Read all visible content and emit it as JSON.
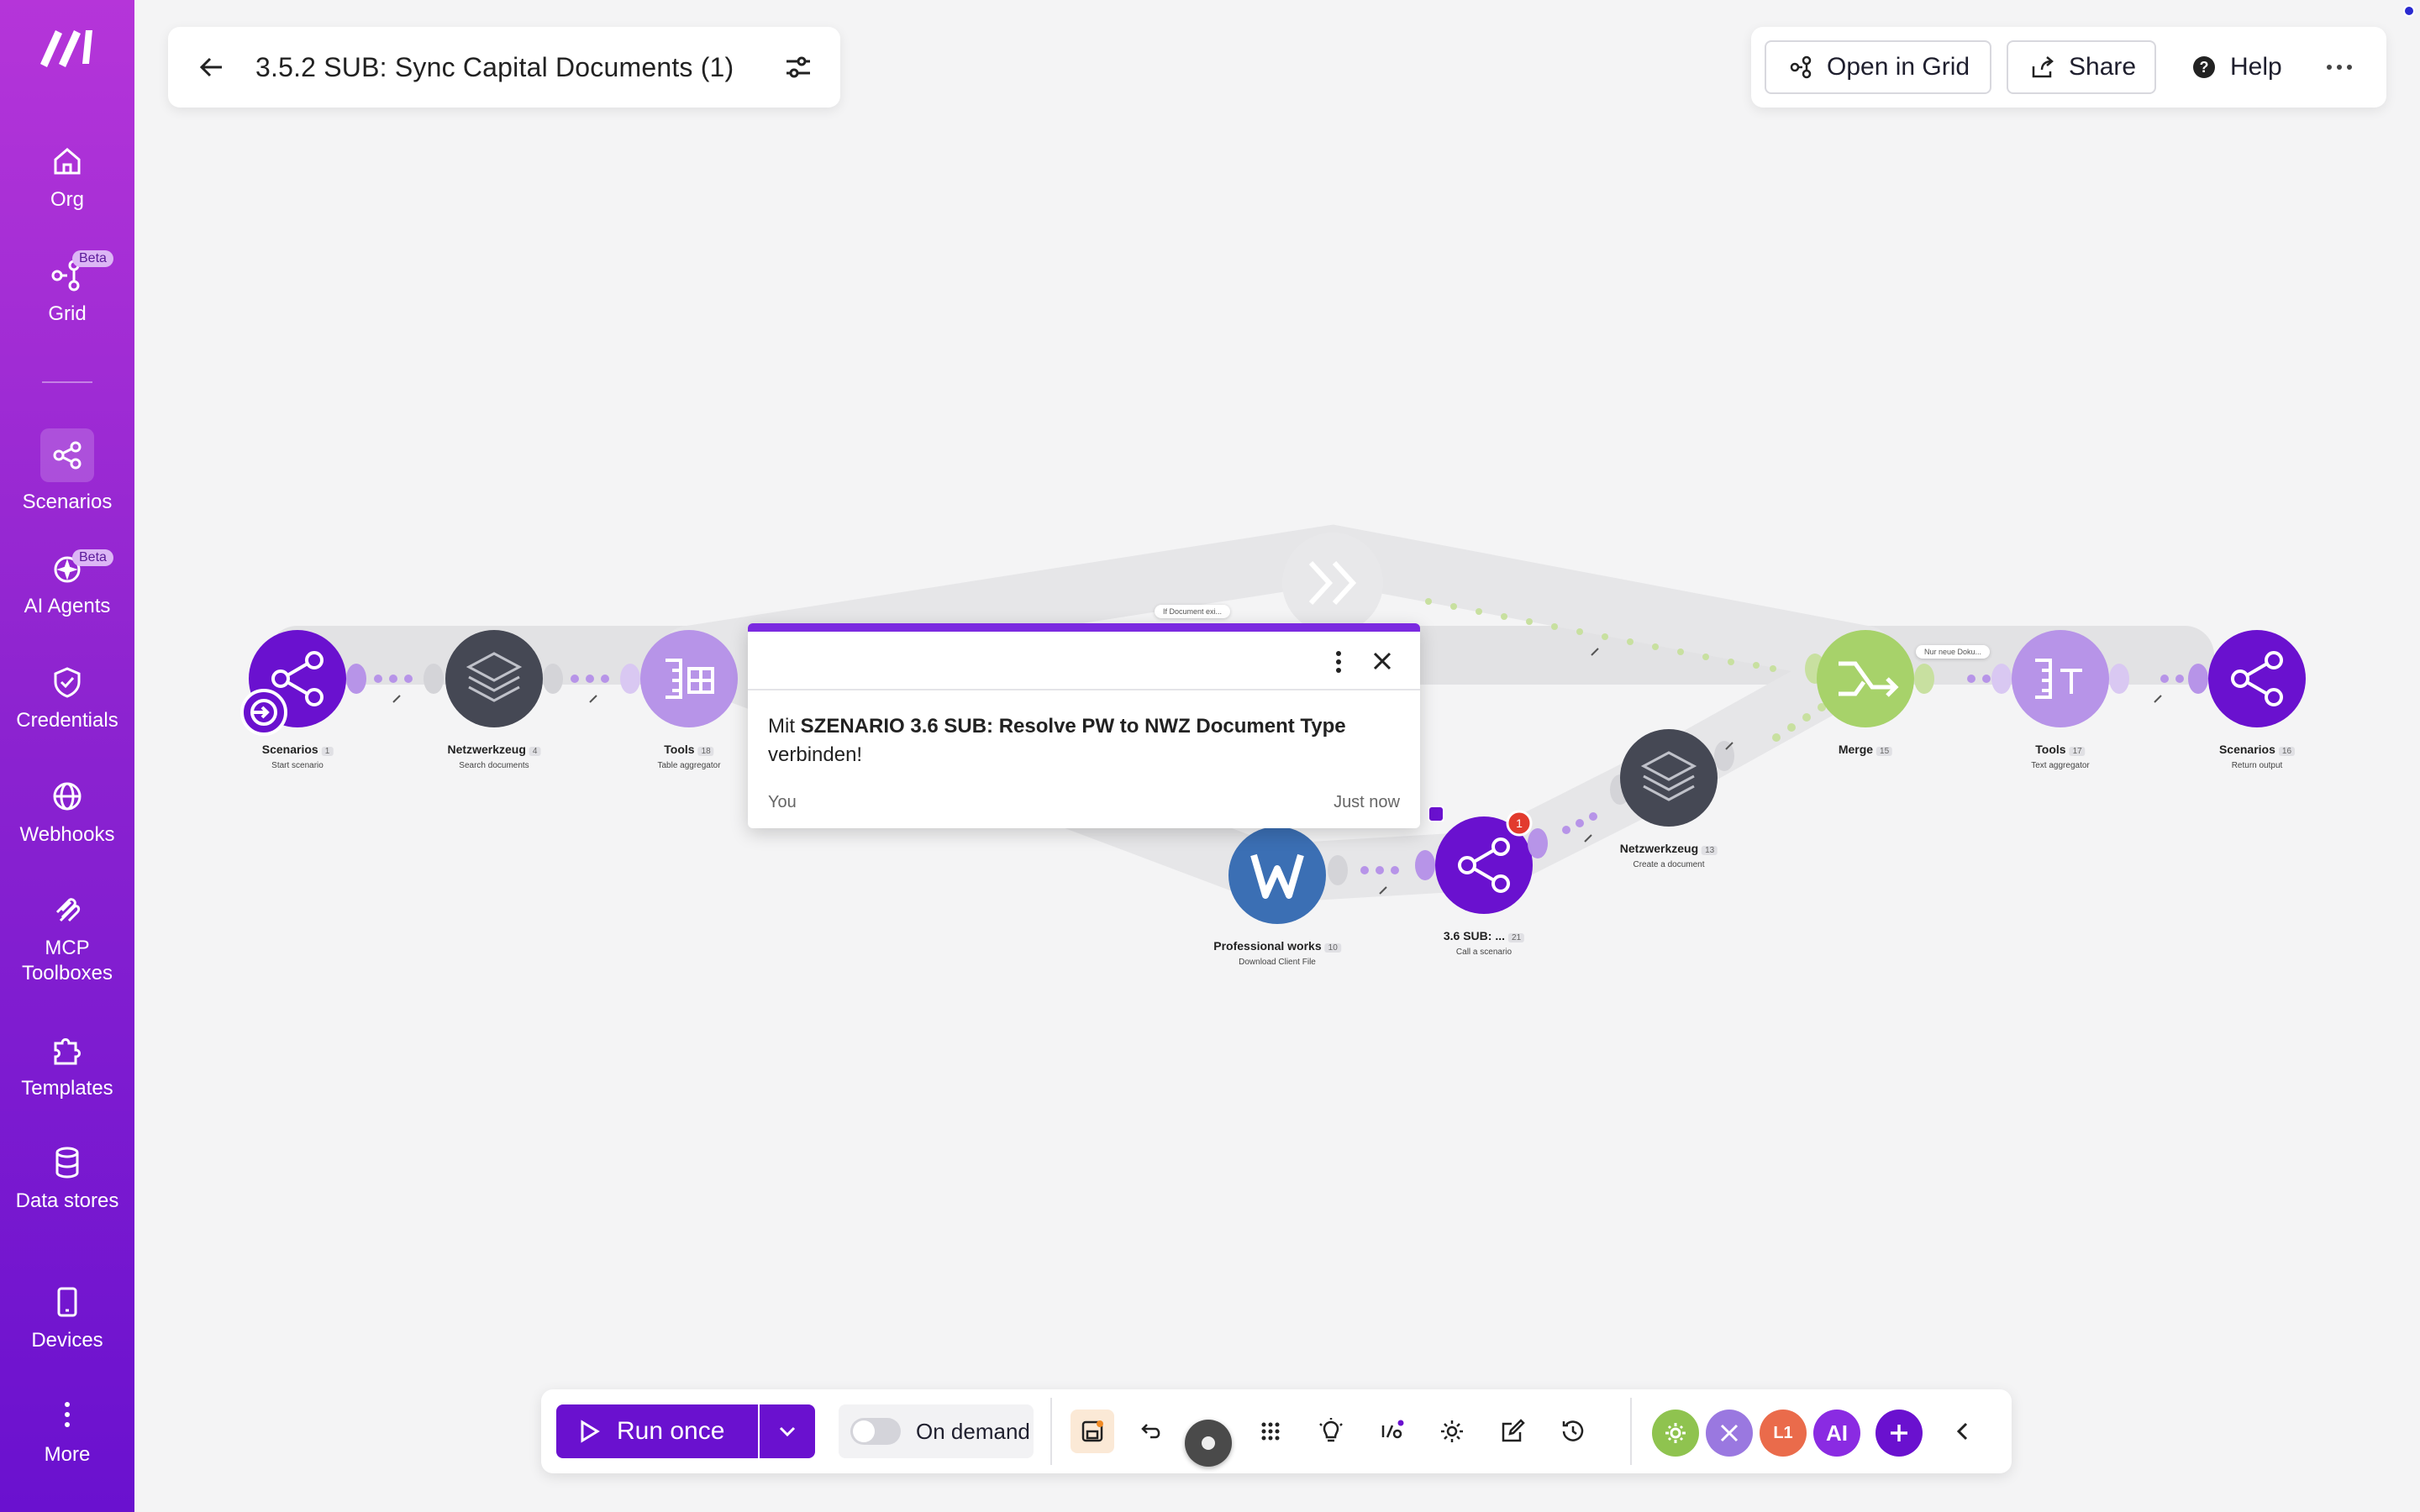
{
  "colors": {
    "brand": "#6a11cf",
    "sidebar_top": "#b535d9",
    "node_purple": "#6a11cf",
    "node_lilac": "#b794e8",
    "node_dark": "#454854",
    "node_green": "#a7d26a",
    "node_blue": "#3b6fb4"
  },
  "sidebar": {
    "items": [
      {
        "label": "Org",
        "icon": "home-icon"
      },
      {
        "label": "Grid",
        "icon": "grid-icon",
        "badge": "Beta"
      },
      {
        "label": "Scenarios",
        "icon": "share-icon"
      },
      {
        "label": "AI Agents",
        "icon": "ai-agents-icon",
        "badge": "Beta"
      },
      {
        "label": "Credentials",
        "icon": "shield-check-icon"
      },
      {
        "label": "Webhooks",
        "icon": "globe-icon"
      },
      {
        "label": "MCP Toolboxes",
        "icon": "mcp-icon"
      },
      {
        "label": "Templates",
        "icon": "puzzle-icon"
      },
      {
        "label": "Data stores",
        "icon": "database-icon"
      },
      {
        "label": "Devices",
        "icon": "phone-icon"
      },
      {
        "label": "More",
        "icon": "dots-vertical-icon"
      }
    ]
  },
  "header": {
    "title": "3.5.2 SUB: Sync Capital Documents (1)",
    "open_in_grid": "Open in Grid",
    "share": "Share",
    "help": "Help"
  },
  "nodes": [
    {
      "name": "Scenarios",
      "num": "1",
      "sub": "Start scenario"
    },
    {
      "name": "Netzwerkzeug",
      "num": "4",
      "sub": "Search documents"
    },
    {
      "name": "Tools",
      "num": "18",
      "sub": "Table aggregator"
    },
    {
      "name": "Professional works",
      "num": "10",
      "sub": "Download Client File"
    },
    {
      "name": "3.6 SUB: ...",
      "num": "21",
      "sub": "Call a scenario"
    },
    {
      "name": "Netzwerkzeug",
      "num": "13",
      "sub": "Create a document"
    },
    {
      "name": "Merge",
      "num": "15",
      "sub": ""
    },
    {
      "name": "Tools",
      "num": "17",
      "sub": "Text aggregator"
    },
    {
      "name": "Scenarios",
      "num": "16",
      "sub": "Return output"
    }
  ],
  "filters": {
    "top": "If Document exi...",
    "right": "Nur neue Doku..."
  },
  "badge_count": "1",
  "comment": {
    "prefix": "Mit ",
    "bold": "SZENARIO 3.6 SUB: Resolve PW to NWZ Document Type",
    "suffix": " verbinden!",
    "author": "You",
    "time": "Just now"
  },
  "toolbar": {
    "run_label": "Run once",
    "schedule_label": "On demand",
    "ai_label": "AI",
    "l1_label": "L1"
  }
}
